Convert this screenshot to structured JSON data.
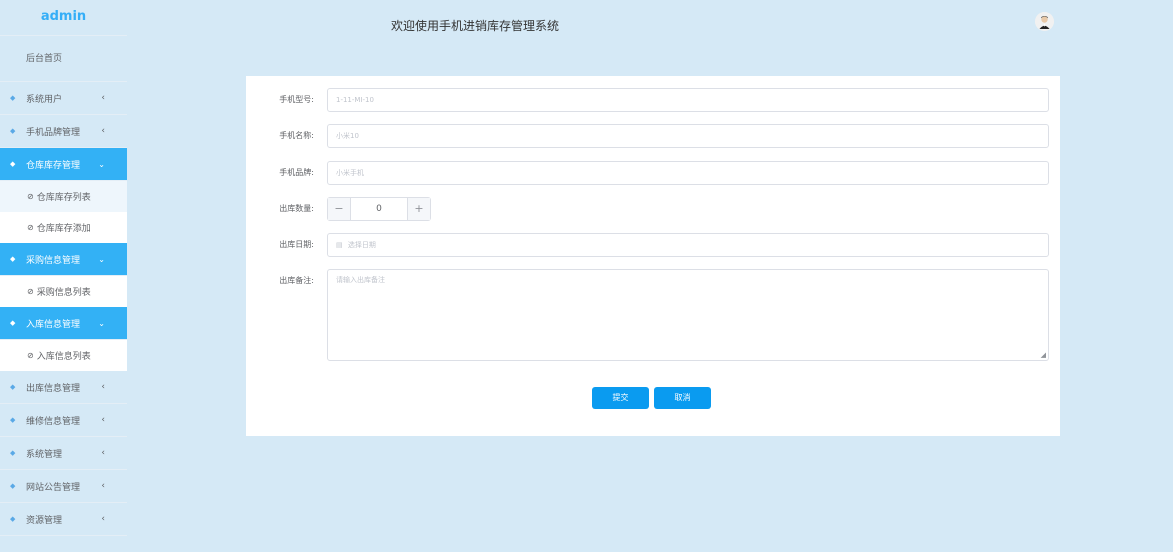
{
  "sidebar": {
    "logo": "admin",
    "home": "后台首页",
    "items": [
      {
        "label": "系统用户",
        "arrow": "‹"
      },
      {
        "label": "手机品牌管理",
        "arrow": "‹"
      },
      {
        "label": "仓库库存管理",
        "arrow": "⌄",
        "subs": [
          "仓库库存列表",
          "仓库库存添加"
        ]
      },
      {
        "label": "采购信息管理",
        "arrow": "⌄",
        "subs": [
          "采购信息列表"
        ]
      },
      {
        "label": "入库信息管理",
        "arrow": "⌄",
        "subs": [
          "入库信息列表"
        ]
      },
      {
        "label": "出库信息管理",
        "arrow": "‹"
      },
      {
        "label": "维修信息管理",
        "arrow": "‹"
      },
      {
        "label": "系统管理",
        "arrow": "‹"
      },
      {
        "label": "网站公告管理",
        "arrow": "‹"
      },
      {
        "label": "资源管理",
        "arrow": "‹"
      }
    ]
  },
  "header": {
    "title": "欢迎使用手机进销库存管理系统"
  },
  "form": {
    "model_label": "手机型号:",
    "model_value": "1-11-MI-10",
    "name_label": "手机名称:",
    "name_value": "小米10",
    "brand_label": "手机品牌:",
    "brand_value": "小米手机",
    "qty_label": "出库数量:",
    "qty_value": "0",
    "qty_minus": "−",
    "qty_plus": "+",
    "date_label": "出库日期:",
    "date_placeholder": "选择日期",
    "date_icon": "▤",
    "note_label": "出库备注:",
    "note_placeholder": "请输入出库备注",
    "submit": "提交",
    "cancel": "取消"
  },
  "colors": {
    "accent": "#33b1f5",
    "button": "#0a9bf0",
    "background": "#d5e9f6"
  }
}
